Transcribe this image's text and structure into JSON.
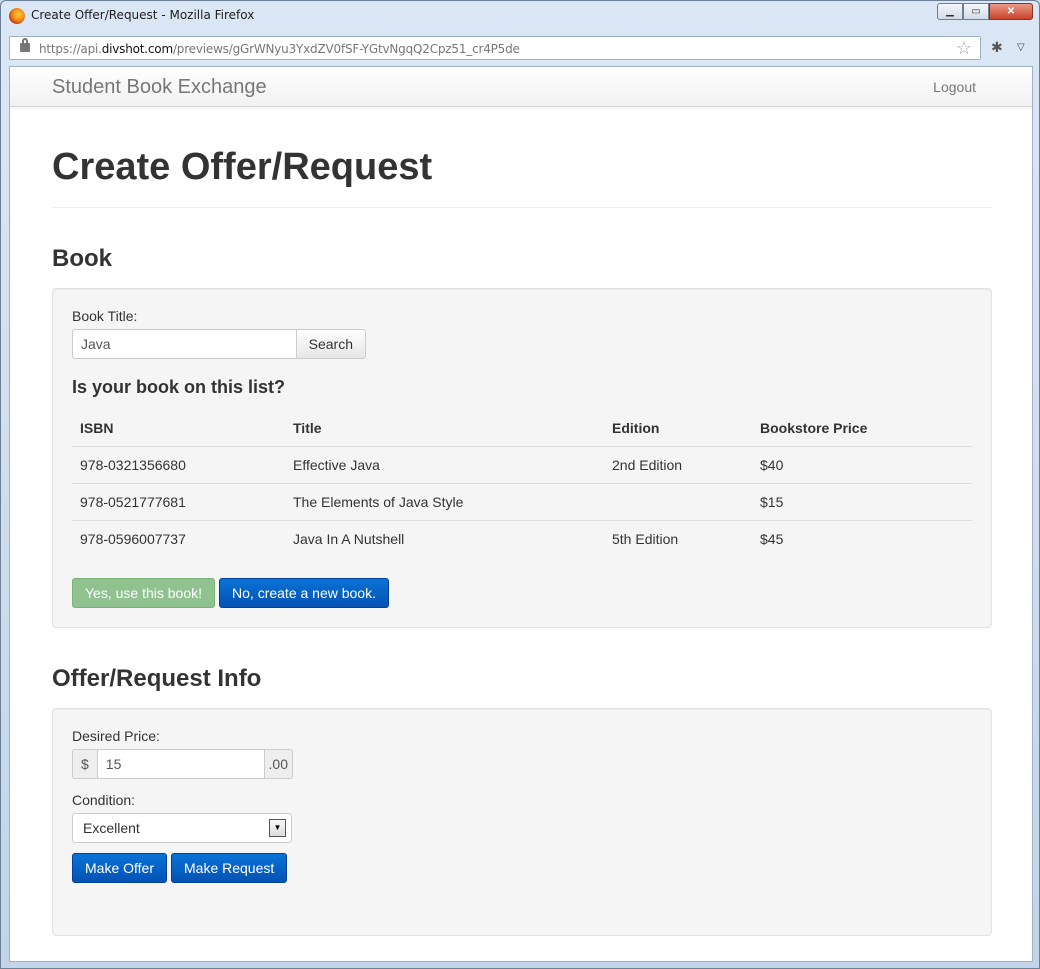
{
  "window": {
    "title": "Create Offer/Request - Mozilla Firefox",
    "url_prefix": "https://api.",
    "url_domain": "divshot.com",
    "url_path": "/previews/gGrWNyu3YxdZV0fSF-YGtvNgqQ2Cpz51_cr4P5de"
  },
  "navbar": {
    "brand": "Student Book Exchange",
    "logout": "Logout"
  },
  "page": {
    "title": "Create Offer/Request"
  },
  "book_section": {
    "heading": "Book",
    "title_label": "Book Title:",
    "title_value": "Java",
    "search_button": "Search",
    "question": "Is your book on this list?",
    "columns": [
      "ISBN",
      "Title",
      "Edition",
      "Bookstore Price"
    ],
    "rows": [
      [
        "978-0321356680",
        "Effective Java",
        "2nd Edition",
        "$40"
      ],
      [
        "978-0521777681",
        "The Elements of Java Style",
        "",
        "$15"
      ],
      [
        "978-0596007737",
        "Java In A Nutshell",
        "5th Edition",
        "$45"
      ]
    ],
    "use_button": "Yes, use this book!",
    "create_button": "No, create a new book."
  },
  "offer_section": {
    "heading": "Offer/Request Info",
    "price_label": "Desired Price:",
    "currency": "$",
    "price_value": "15",
    "cents": ".00",
    "condition_label": "Condition:",
    "condition_value": "Excellent",
    "offer_button": "Make Offer",
    "request_button": "Make Request"
  }
}
